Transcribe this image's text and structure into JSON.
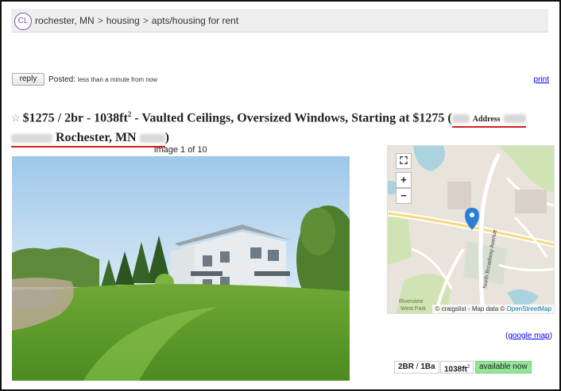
{
  "header": {
    "logo": "CL",
    "breadcrumb": [
      "rochester, MN",
      "housing",
      "apts/housing for rent"
    ],
    "separator": ">"
  },
  "toolbar": {
    "reply_label": "reply",
    "posted_label": "Posted:",
    "posted_time": "less than a minute from now",
    "print_label": "print"
  },
  "posting": {
    "star": "☆",
    "title_main": "$1275 / 2br - 1038ft",
    "title_sup": "2",
    "title_rest": " - Vaulted Ceilings, Oversized Windows, Starting at $1275 (",
    "address_label": "Address",
    "city": "Rochester, MN",
    "close_paren": ")"
  },
  "gallery": {
    "counter": "image 1 of 10"
  },
  "map": {
    "attribution_prefix": "© craigslist - Map data © ",
    "attribution_link": "OpenStreetMap",
    "street_label": "North Broadway Avenue",
    "park_label_1": "Riverview",
    "park_label_2": "West Park",
    "google_prefix": "(",
    "google_link": "google map",
    "google_suffix": ")"
  },
  "attributes": {
    "beds": "2BR",
    "slash": " / ",
    "baths": "1Ba",
    "sqft": "1038ft",
    "sqft_sup": "2",
    "availability": "available now"
  }
}
